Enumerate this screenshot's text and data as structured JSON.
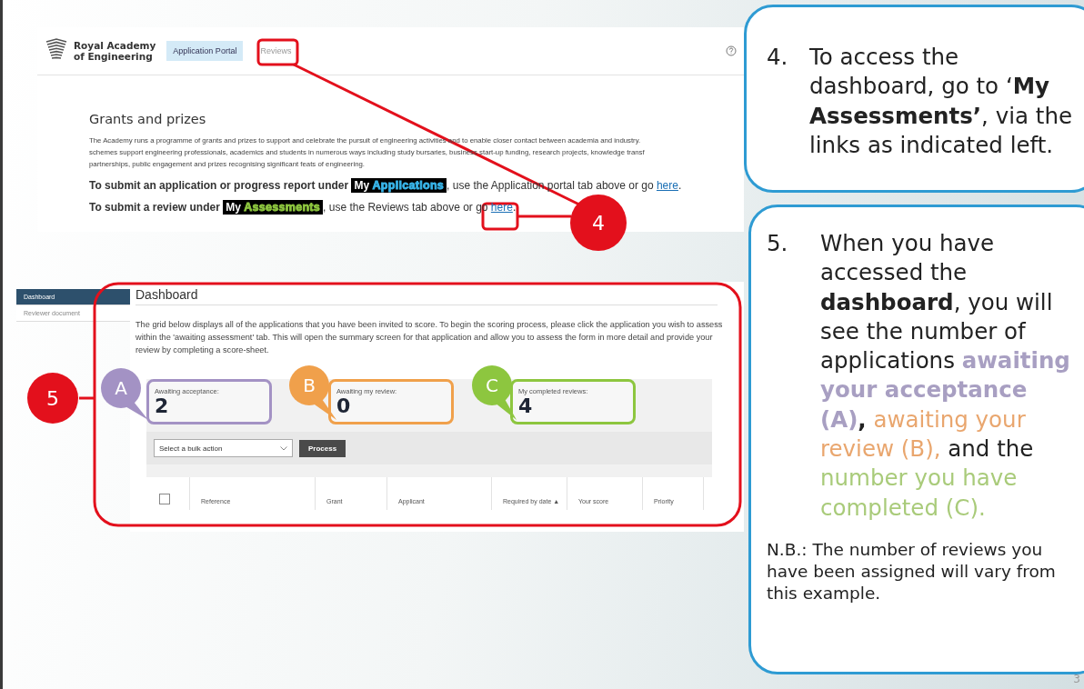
{
  "portal_screenshot": {
    "logo_lines": [
      "Royal Academy",
      "of Engineering"
    ],
    "tabs": [
      {
        "label": "Application Portal",
        "selected": true
      },
      {
        "label": "Reviews",
        "selected": false
      }
    ],
    "heading": "Grants and prizes",
    "intro_lines": [
      "The Academy runs a programme of grants and prizes to support and celebrate the pursuit of engineering activities and to enable closer contact between academia and industry.",
      "schemes support engineering professionals, academics and students in numerous ways including study bursaries, business start-up funding, research projects, knowledge transf",
      "partnerships, public engagement and prizes recognising significant feats of engineering."
    ],
    "instructions": [
      {
        "lead": "To submit an application or progress report under",
        "tag_first": "My",
        "tag_second": "Applications",
        "color": "#38b4e8",
        "middle": ", use the Application portal tab above or go ",
        "link": "here",
        "end": "."
      },
      {
        "lead": "To submit a review under",
        "tag_first": "My",
        "tag_second": "Assessments",
        "color": "#8dc63f",
        "middle": ", use the Reviews tab above or go ",
        "link": "here",
        "end": "."
      }
    ]
  },
  "dashboard_screenshot": {
    "sidebar": [
      {
        "label": "Dashboard",
        "selected": true
      },
      {
        "label": "Reviewer document",
        "selected": false
      }
    ],
    "title": "Dashboard",
    "intro": "The grid below displays all of the applications that you have been invited to score. To begin the scoring process, please click the application you wish to assess within the 'awaiting assessment' tab. This will open the summary screen for that application and allow you to assess the form in more detail and provide your review by completing a score-sheet.",
    "stats": [
      {
        "letter": "A",
        "label": "Awaiting acceptance:",
        "count": "2",
        "color": "#a392c4"
      },
      {
        "letter": "B",
        "label": "Awaiting my review:",
        "count": "0",
        "color": "#f0a04b"
      },
      {
        "letter": "C",
        "label": "My completed reviews:",
        "count": "4",
        "color": "#8dc63f"
      }
    ],
    "bulk_action": {
      "placeholder": "Select a bulk action"
    },
    "process_button": "Process",
    "select_all": {
      "checked": false
    },
    "columns": [
      "Reference",
      "Grant",
      "Applicant",
      "Required by date ▲",
      "Your score",
      "Priority"
    ]
  },
  "step_badges": [
    {
      "label": "4"
    },
    {
      "label": "5"
    }
  ],
  "callouts": [
    {
      "number": "4.",
      "segments": [
        {
          "text": "To access the dashboard, go to ‘**My Assessments’**, via the links as indicated left."
        }
      ]
    },
    {
      "number": "5.",
      "segments": [
        {
          "text": "When you have accessed the **dashboard**, you will see the number of applications "
        },
        {
          "text": "**awaiting your acceptance (A)**",
          "color": "#a89fc2"
        },
        {
          "text": "**,** "
        },
        {
          "text": "awaiting your review (B),",
          "color": "#e9a66e"
        },
        {
          "text": " and the "
        },
        {
          "text": "number you have completed (C).",
          "color": "#a9cb7a"
        }
      ],
      "note": "N.B.:  The number of reviews you have been assigned will vary from this example."
    }
  ],
  "page_number": "3"
}
